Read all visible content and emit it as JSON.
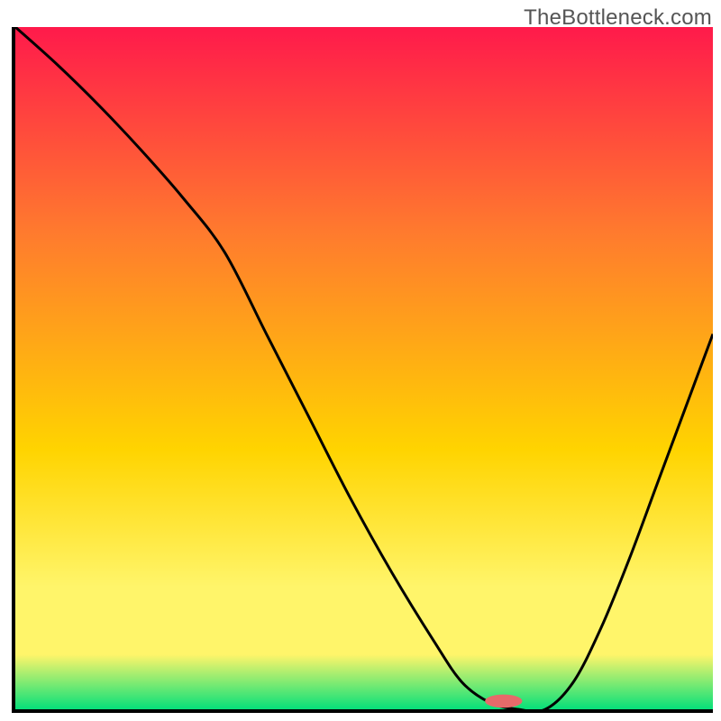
{
  "watermark": "TheBottleneck.com",
  "colors": {
    "gradient_top": "#ff1a4b",
    "gradient_mid1": "#ff7a2e",
    "gradient_mid2": "#ffd400",
    "gradient_mid3": "#fff56a",
    "gradient_bottom": "#06e07a",
    "curve": "#000000",
    "marker_fill": "#e66a6a",
    "marker_stroke": "#e66a6a"
  },
  "chart_data": {
    "type": "line",
    "title": "",
    "xlabel": "",
    "ylabel": "",
    "xlim": [
      0,
      100
    ],
    "ylim": [
      0,
      100
    ],
    "grid": false,
    "legend": false,
    "series": [
      {
        "name": "curve",
        "x": [
          0,
          6,
          12,
          18,
          24,
          30,
          36,
          42,
          48,
          54,
          60,
          64,
          68,
          72,
          76,
          80,
          84,
          88,
          92,
          96,
          100
        ],
        "values": [
          100,
          94.5,
          88.5,
          82,
          75,
          67,
          55,
          43,
          31,
          20,
          10,
          4,
          1,
          0,
          0,
          4,
          12,
          22,
          33,
          44,
          55
        ]
      }
    ],
    "marker": {
      "x": 70,
      "y": 1.2,
      "rx": 2.6,
      "ry": 0.9
    },
    "annotations": []
  }
}
